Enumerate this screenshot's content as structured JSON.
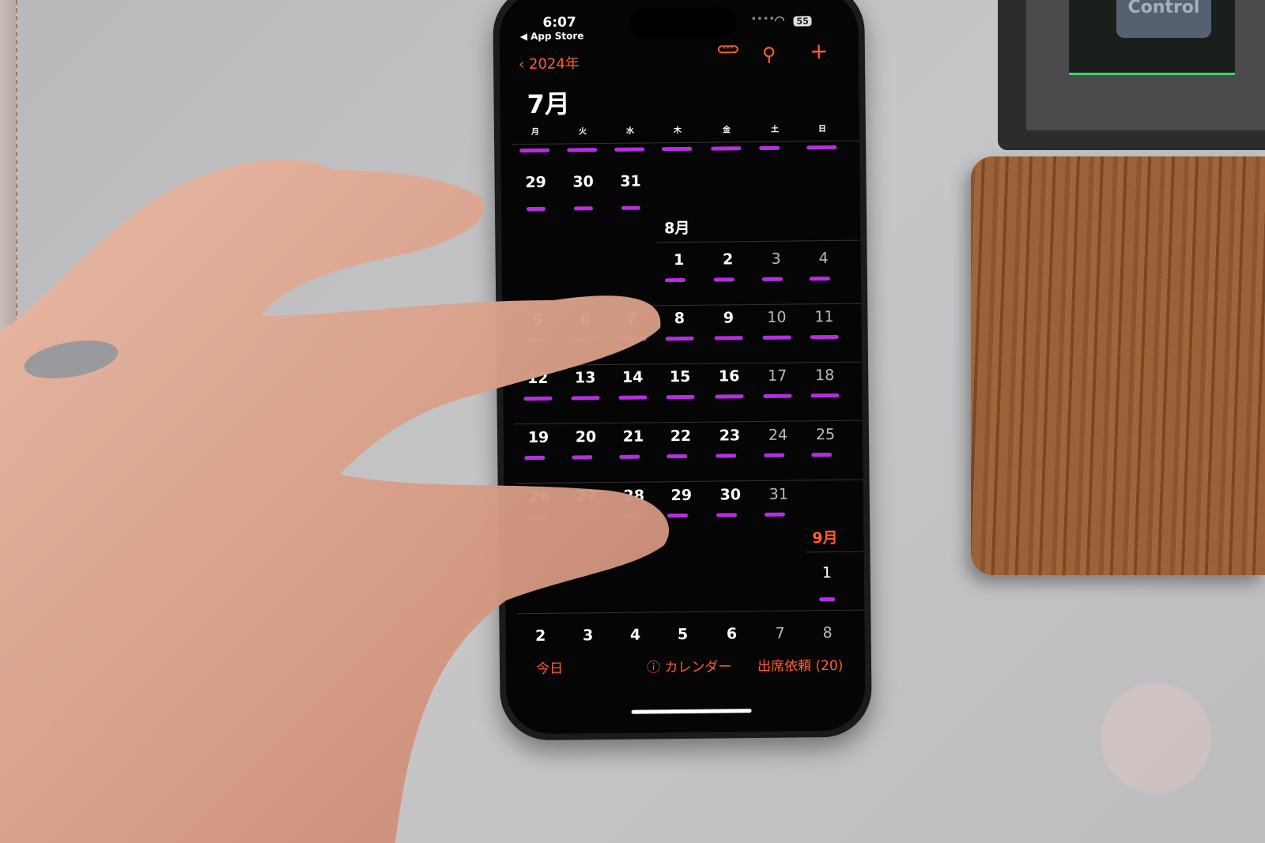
{
  "status_bar": {
    "time": "6:07",
    "back_app": "◀ App Store",
    "battery": "55"
  },
  "nav": {
    "back_label": "2024年",
    "icons": [
      "chevron-left-icon",
      "list-view-icon",
      "search-icon",
      "plus-icon"
    ]
  },
  "month_title": "7月",
  "weekdays": [
    "月",
    "火",
    "水",
    "木",
    "金",
    "土",
    "日"
  ],
  "july_tail": [
    "29",
    "30",
    "31"
  ],
  "august_label": "8月",
  "august_weeks": [
    [
      "",
      "",
      "",
      "1",
      "2",
      "3",
      "4"
    ],
    [
      "5",
      "6",
      "7",
      "8",
      "9",
      "10",
      "11"
    ],
    [
      "12",
      "13",
      "14",
      "15",
      "16",
      "17",
      "18"
    ],
    [
      "19",
      "20",
      "21",
      "22",
      "23",
      "24",
      "25"
    ],
    [
      "26",
      "27",
      "28",
      "29",
      "30",
      "31",
      ""
    ]
  ],
  "september_label": "9月",
  "september_weeks": [
    [
      "",
      "",
      "",
      "",
      "",
      "",
      "1"
    ],
    [
      "2",
      "3",
      "4",
      "5",
      "6",
      "7",
      "8"
    ]
  ],
  "toolbar": {
    "today": "今日",
    "calendars": "カレンダー",
    "invitations": "出席依頼 (20)"
  },
  "colors": {
    "accent": "#ff5f2e",
    "event_purple": "#b52fe0",
    "event_blue": "#4aa8e0",
    "event_yellow": "#d9c36a"
  },
  "background_keycap": "Control"
}
